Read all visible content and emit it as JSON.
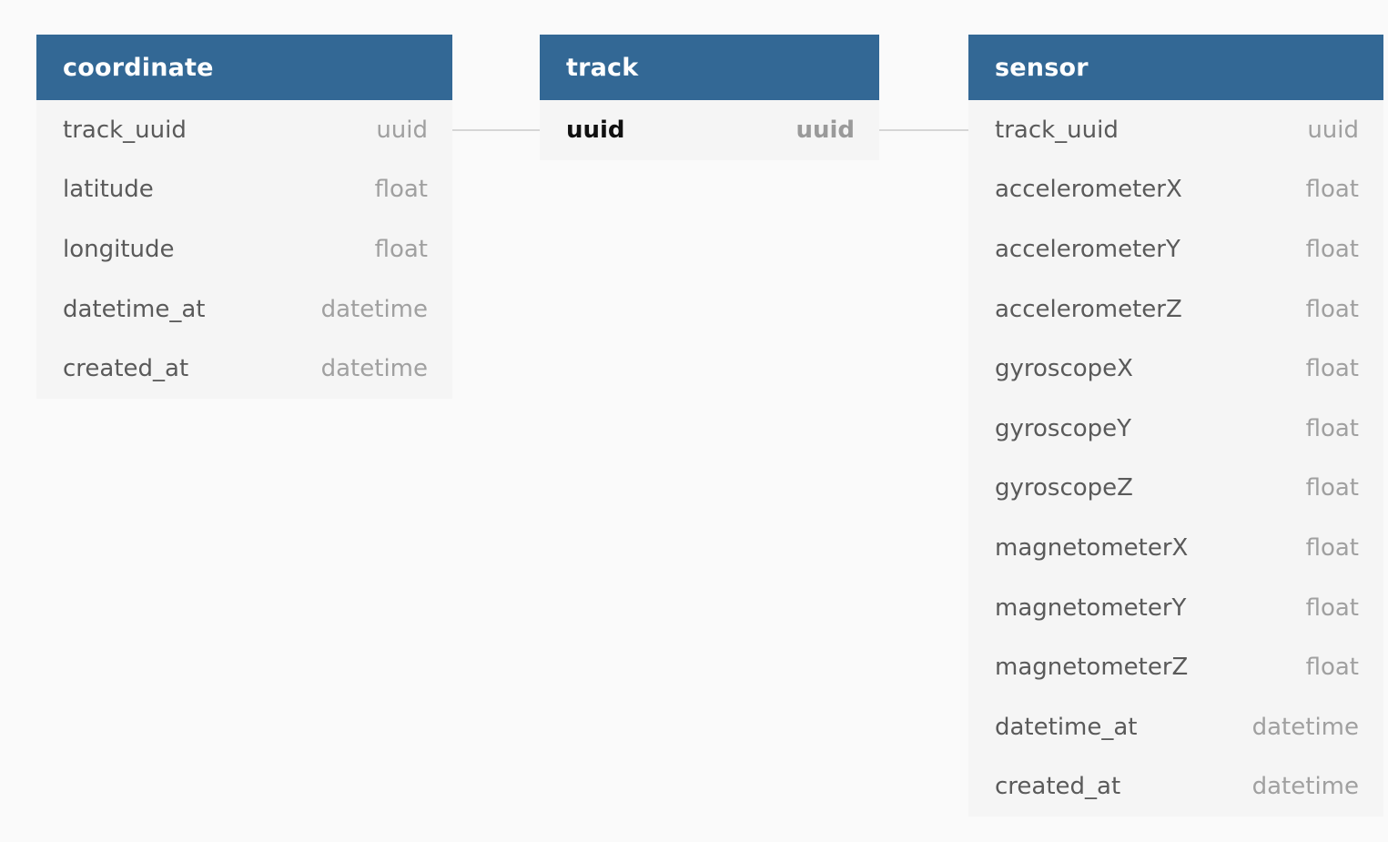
{
  "colors": {
    "background": "#fafafa",
    "header": "#336895",
    "header_text": "#ffffff",
    "table_body": "#f5f5f5",
    "field_name": "#5a5a5a",
    "field_type": "#a0a0a0",
    "connector": "#d6d6d6"
  },
  "tables": [
    {
      "name": "coordinate",
      "fields": [
        {
          "name": "track_uuid",
          "type": "uuid",
          "pk": false
        },
        {
          "name": "latitude",
          "type": "float",
          "pk": false
        },
        {
          "name": "longitude",
          "type": "float",
          "pk": false
        },
        {
          "name": "datetime_at",
          "type": "datetime",
          "pk": false
        },
        {
          "name": "created_at",
          "type": "datetime",
          "pk": false
        }
      ]
    },
    {
      "name": "track",
      "fields": [
        {
          "name": "uuid",
          "type": "uuid",
          "pk": true
        }
      ]
    },
    {
      "name": "sensor",
      "fields": [
        {
          "name": "track_uuid",
          "type": "uuid",
          "pk": false
        },
        {
          "name": "accelerometerX",
          "type": "float",
          "pk": false
        },
        {
          "name": "accelerometerY",
          "type": "float",
          "pk": false
        },
        {
          "name": "accelerometerZ",
          "type": "float",
          "pk": false
        },
        {
          "name": "gyroscopeX",
          "type": "float",
          "pk": false
        },
        {
          "name": "gyroscopeY",
          "type": "float",
          "pk": false
        },
        {
          "name": "gyroscopeZ",
          "type": "float",
          "pk": false
        },
        {
          "name": "magnetometerX",
          "type": "float",
          "pk": false
        },
        {
          "name": "magnetometerY",
          "type": "float",
          "pk": false
        },
        {
          "name": "magnetometerZ",
          "type": "float",
          "pk": false
        },
        {
          "name": "datetime_at",
          "type": "datetime",
          "pk": false
        },
        {
          "name": "created_at",
          "type": "datetime",
          "pk": false
        }
      ]
    }
  ],
  "relations": [
    {
      "from": "coordinate.track_uuid",
      "to": "track.uuid"
    },
    {
      "from": "track.uuid",
      "to": "sensor.track_uuid"
    }
  ]
}
